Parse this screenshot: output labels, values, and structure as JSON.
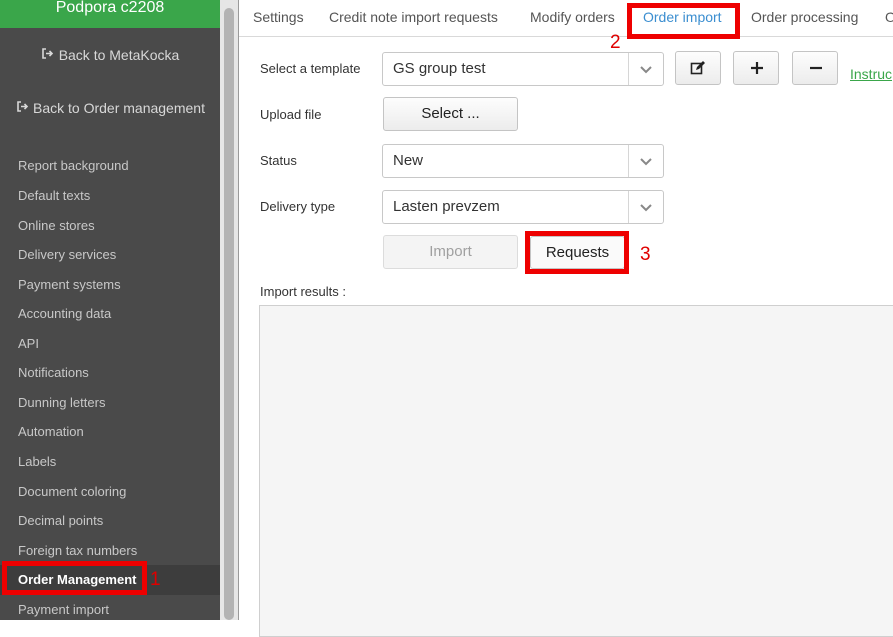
{
  "sidebar": {
    "company": "Podpora c2208",
    "back_links": [
      {
        "label": "Back to MetaKocka"
      },
      {
        "label": "Back to Order management"
      }
    ],
    "menu": [
      {
        "label": "Report background"
      },
      {
        "label": "Default texts"
      },
      {
        "label": "Online stores"
      },
      {
        "label": "Delivery services"
      },
      {
        "label": "Payment systems"
      },
      {
        "label": "Accounting data"
      },
      {
        "label": "API"
      },
      {
        "label": "Notifications"
      },
      {
        "label": "Dunning letters"
      },
      {
        "label": "Automation"
      },
      {
        "label": "Labels"
      },
      {
        "label": "Document coloring"
      },
      {
        "label": "Decimal points"
      },
      {
        "label": "Foreign tax numbers"
      },
      {
        "label": "Order Management",
        "active": true
      },
      {
        "label": "Payment import"
      }
    ]
  },
  "tabs": [
    {
      "label": "Settings"
    },
    {
      "label": "Credit note import requests"
    },
    {
      "label": "Modify orders"
    },
    {
      "label": "Order import",
      "active": true
    },
    {
      "label": "Order processing"
    },
    {
      "label": "O"
    }
  ],
  "form": {
    "template_label": "Select a template",
    "template_value": "GS group test",
    "upload_label": "Upload file",
    "upload_button": "Select ...",
    "status_label": "Status",
    "status_value": "New",
    "delivery_label": "Delivery type",
    "delivery_value": "Lasten prevzem",
    "import_button": "Import",
    "requests_button": "Requests",
    "instructions_link": "Instruc",
    "results_label": "Import results :"
  },
  "icons": {
    "edit": "edit-icon",
    "add": "plus-icon",
    "remove": "minus-icon",
    "back": "sign-out-icon",
    "dropdown": "chevron-down-icon"
  },
  "annotations": [
    "1",
    "2",
    "3"
  ],
  "colors": {
    "brand_green": "#3aa64a",
    "active_tab": "#3b8ed0",
    "annotation_red": "#ee0000",
    "sidebar_bg": "#4a4a4a"
  }
}
